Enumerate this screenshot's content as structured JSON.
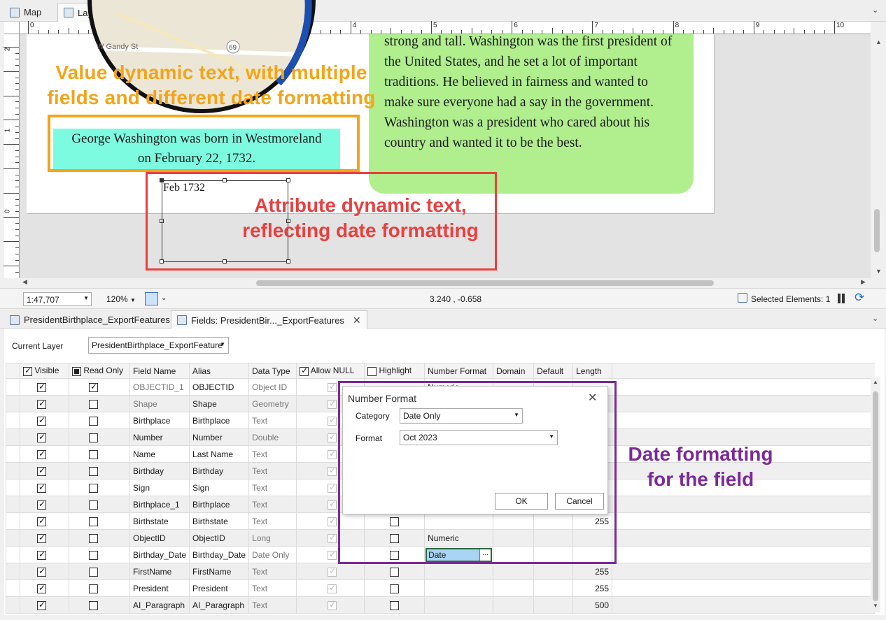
{
  "tabs_top": [
    {
      "label": "Map"
    },
    {
      "label": "Layout"
    }
  ],
  "ruler": {
    "top_numbers": [
      "0",
      "1",
      "2",
      "3",
      "4",
      "5",
      "6",
      "7",
      "8",
      "9",
      "10"
    ],
    "left_numbers": [
      "2",
      "1",
      "0"
    ]
  },
  "page": {
    "value_text": "George Washington was born in Westmoreland on February 22, 1732.",
    "attribute_text": "Feb 1732",
    "paragraph": "strong and tall. Washington was the first president of the United States, and he set a lot of important traditions. He believed in fairness and wanted to make sure everyone had a say in the government. Washington was a president who cared about his country and wanted it to be the best.",
    "map_labels": {
      "street": "W Gandy St",
      "route": "69"
    }
  },
  "annotations": {
    "value": "Value dynamic text, with multiple fields and different date formatting",
    "attribute": "Attribute dynamic text, reflecting date formatting",
    "date_field": "Date formatting for the field",
    "colors": {
      "orange": "#f2a51a",
      "red": "#e84040",
      "purple": "#7b2a96"
    }
  },
  "status": {
    "scale": "1:47,707",
    "zoom": "120%",
    "coords": "3.240 , -0.658",
    "selected": "Selected Elements: 1"
  },
  "tabs_bottom": [
    {
      "label": "PresidentBirthplace_ExportFeatures"
    },
    {
      "label": "Fields: PresidentBir..._ExportFeatures"
    }
  ],
  "current_layer": {
    "label": "Current Layer",
    "value": "PresidentBirthplace_ExportFeature"
  },
  "columns": [
    "Visible",
    "Read Only",
    "Field Name",
    "Alias",
    "Data Type",
    "Allow NULL",
    "Highlight",
    "Number Format",
    "Domain",
    "Default",
    "Length"
  ],
  "rows": [
    {
      "name": "OBJECTID_1",
      "alias": "OBJECTID",
      "type": "Object ID",
      "ro": true,
      "format": "Numeric",
      "length": ""
    },
    {
      "name": "Shape",
      "alias": "Shape",
      "type": "Geometry",
      "ro": false,
      "format": "",
      "length": ""
    },
    {
      "name": "Birthplace",
      "alias": "Birthplace",
      "type": "Text",
      "ro": false,
      "format": "",
      "length": ""
    },
    {
      "name": "Number",
      "alias": "Number",
      "type": "Double",
      "ro": false,
      "format": "",
      "length": ""
    },
    {
      "name": "Name",
      "alias": "Last Name",
      "type": "Text",
      "ro": false,
      "format": "",
      "length": ""
    },
    {
      "name": "Birthday",
      "alias": "Birthday",
      "type": "Text",
      "ro": false,
      "format": "",
      "length": ""
    },
    {
      "name": "Sign",
      "alias": "Sign",
      "type": "Text",
      "ro": false,
      "format": "",
      "length": ""
    },
    {
      "name": "Birthplace_1",
      "alias": "Birthplace",
      "type": "Text",
      "ro": false,
      "format": "",
      "length": ""
    },
    {
      "name": "Birthstate",
      "alias": "Birthstate",
      "type": "Text",
      "ro": false,
      "format": "",
      "length": "255"
    },
    {
      "name": "ObjectID",
      "alias": "ObjectID",
      "type": "Long",
      "ro": false,
      "format": "Numeric",
      "length": ""
    },
    {
      "name": "Birthday_Date",
      "alias": "Birthday_Date",
      "type": "Date Only",
      "ro": false,
      "format": "Date",
      "length": ""
    },
    {
      "name": "FirstName",
      "alias": "FirstName",
      "type": "Text",
      "ro": false,
      "format": "",
      "length": "255"
    },
    {
      "name": "President",
      "alias": "President",
      "type": "Text",
      "ro": false,
      "format": "",
      "length": "255"
    },
    {
      "name": "AI_Paragraph",
      "alias": "AI_Paragraph",
      "type": "Text",
      "ro": false,
      "format": "",
      "length": "500"
    }
  ],
  "dialog": {
    "title": "Number Format",
    "category_label": "Category",
    "category_value": "Date Only",
    "format_label": "Format",
    "format_value": "Oct 2023",
    "ok": "OK",
    "cancel": "Cancel"
  }
}
